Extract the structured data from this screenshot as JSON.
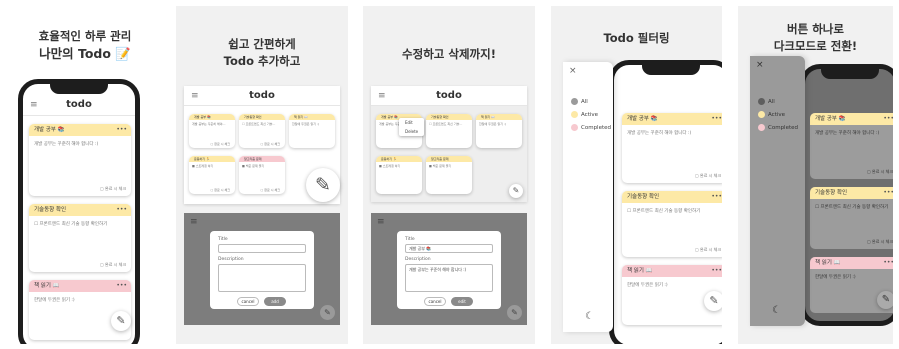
{
  "panel1": {
    "caption_line1": "효율적인 하루 관리",
    "caption_line2": "나만의 Todo 📝",
    "app_title": "todo",
    "menu_icon": "≡",
    "cards": [
      {
        "title": "개발 공부 📚",
        "body": "개발 공부는 꾸준히 해야 합니다 :)",
        "footer": "▢ 완료 시 체크"
      },
      {
        "title": "기술동향 확인",
        "body": "☐ 프론트엔드 최신 기술 동향 확인하기",
        "footer": "▢ 완료 시 체크"
      },
      {
        "title": "책 읽기 📖",
        "body": "한달에 두권은 읽기 :)",
        "footer": ""
      }
    ],
    "menu_dots": "•••"
  },
  "panel2": {
    "caption_line1": "쉽고 간편하게",
    "caption_line2": "Todo 추가하고",
    "app_title": "todo",
    "menu_icon": "≡",
    "mini_cards": [
      {
        "title": "개발 공부 📚",
        "body": "개발 공부는 꾸준히 해야…",
        "footer": "▢ 완료 시 체크",
        "color": "y"
      },
      {
        "title": "기술동향 확인",
        "body": "☐ 프론트엔드 최신 기술…",
        "footer": "▢ 완료 시 체크",
        "color": "y"
      },
      {
        "title": "책 읽기 📖",
        "body": "한달에 두권은 읽기 :)",
        "footer": "",
        "color": "y"
      },
      {
        "title": "운동하기 🏃",
        "body": "■ 스트레칭 하기",
        "footer": "▢ 완료 시 체크",
        "color": "y"
      },
      {
        "title": "알고리즘 문제",
        "body": "■ 백준 문제 풀기",
        "footer": "▢ 완료 시 체크",
        "color": "p"
      }
    ],
    "modal": {
      "title_label": "Title",
      "description_label": "Description",
      "cancel_label": "cancel",
      "add_label": "add"
    }
  },
  "panel3": {
    "caption": "수정하고 삭제까지!",
    "app_title": "todo",
    "menu_icon": "≡",
    "context_menu": [
      "Edit",
      "Delete"
    ],
    "modal": {
      "title_label": "Title",
      "title_value": "개발 공부 📚",
      "description_label": "Description",
      "description_value": "개발 공부는 꾸준히 해야 합니다 :)",
      "cancel_label": "cancel",
      "edit_label": "edit"
    }
  },
  "panel4": {
    "caption": "Todo 필터링",
    "close_icon": "×",
    "filters": [
      {
        "label": "All",
        "color": "#9b9b9b"
      },
      {
        "label": "Active",
        "color": "#fde9a6"
      },
      {
        "label": "Completed",
        "color": "#f7c9cf"
      }
    ],
    "cards": [
      {
        "title": "개발 공부 📚",
        "body": "개발 공부는 꾸준히 해야 합니다 :)",
        "footer": "▢ 완료 시 체크"
      },
      {
        "title": "기술동향 확인",
        "body": "☐ 프론트엔드 최신 기술 동향 확인하기",
        "footer": "▢ 완료 시 체크"
      },
      {
        "title": "책 읽기 📖",
        "body": "한달에 두권은 읽기 :)",
        "footer": ""
      }
    ]
  },
  "panel5": {
    "caption_line1": "버튼 하나로",
    "caption_line2": "다크모드로 전환!",
    "close_icon": "×",
    "filters": [
      {
        "label": "All",
        "color": "#5e5e5e"
      },
      {
        "label": "Active",
        "color": "#fde9a6"
      },
      {
        "label": "Completed",
        "color": "#f7c9cf"
      }
    ],
    "cards": [
      {
        "title": "개발 공부 📚",
        "body": "개발 공부는 꾸준히 해야 합니다 :)",
        "footer": "▢ 완료 시 체크"
      },
      {
        "title": "기술동향 확인",
        "body": "☐ 프론트엔드 최신 기술 동향 확인하기",
        "footer": "▢ 완료 시 체크"
      },
      {
        "title": "책 읽기 📖",
        "body": "한달에 두권은 읽기 :)",
        "footer": ""
      }
    ]
  },
  "icons": {
    "pen": "✎",
    "moon": "☾",
    "dots": "•••"
  }
}
